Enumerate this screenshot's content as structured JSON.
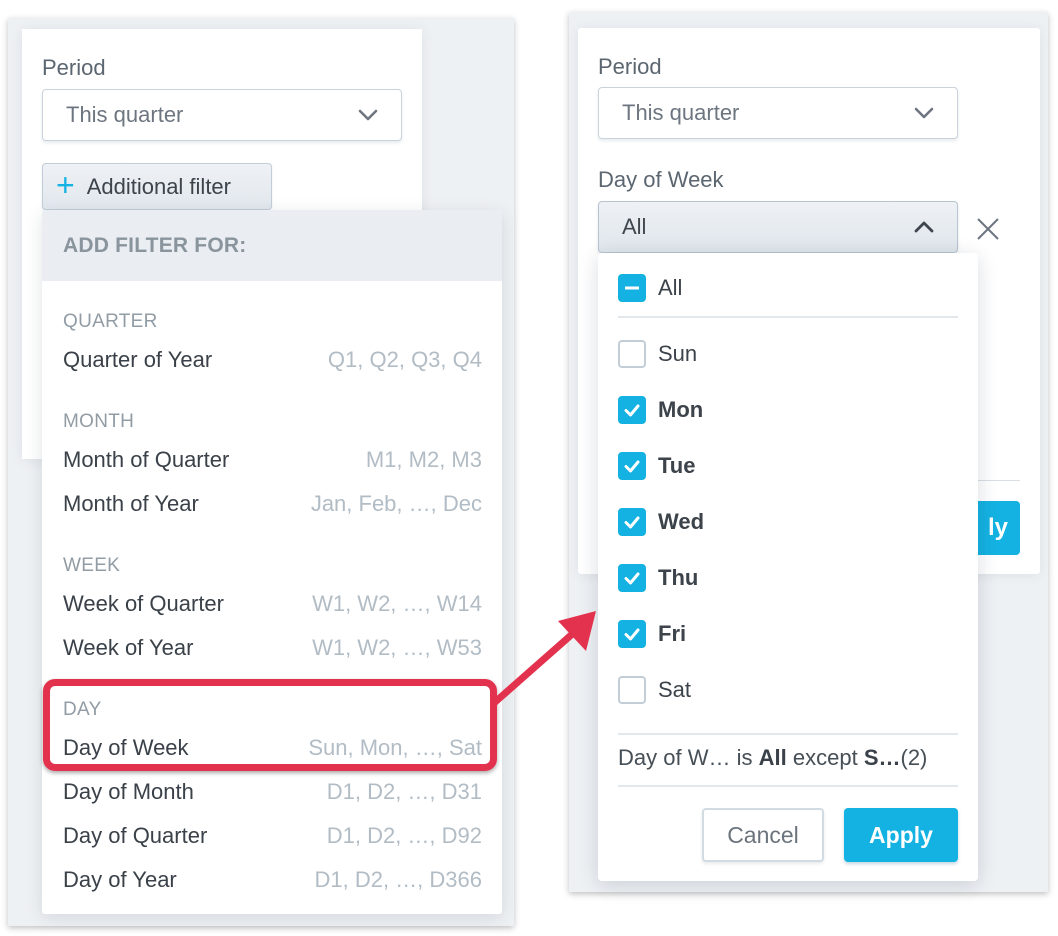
{
  "left_screen": {
    "period_label": "Period",
    "period_value": "This quarter",
    "additional_filter_label": "Additional filter",
    "add_filter_header": "ADD FILTER FOR:",
    "groups": [
      {
        "title": "QUARTER",
        "options": [
          {
            "name": "Quarter of Year",
            "hint": "Q1, Q2, Q3, Q4"
          }
        ]
      },
      {
        "title": "MONTH",
        "options": [
          {
            "name": "Month of Quarter",
            "hint": "M1, M2, M3"
          },
          {
            "name": "Month of Year",
            "hint": "Jan, Feb, …, Dec"
          }
        ]
      },
      {
        "title": "WEEK",
        "options": [
          {
            "name": "Week of Quarter",
            "hint": "W1, W2, …, W14"
          },
          {
            "name": "Week of Year",
            "hint": "W1, W2, …, W53"
          }
        ]
      },
      {
        "title": "DAY",
        "options": [
          {
            "name": "Day of Week",
            "hint": "Sun, Mon, …, Sat",
            "highlighted": true
          },
          {
            "name": "Day of Month",
            "hint": "D1, D2, …, D31"
          },
          {
            "name": "Day of Quarter",
            "hint": "D1, D2, …, D92"
          },
          {
            "name": "Day of Year",
            "hint": "D1, D2, …, D366"
          }
        ]
      }
    ]
  },
  "right_screen": {
    "period_label": "Period",
    "period_value": "This quarter",
    "day_filter_label": "Day of Week",
    "day_filter_value": "All",
    "all_option": {
      "label": "All",
      "state": "partial"
    },
    "days": [
      {
        "label": "Sun",
        "checked": false
      },
      {
        "label": "Mon",
        "checked": true
      },
      {
        "label": "Tue",
        "checked": true
      },
      {
        "label": "Wed",
        "checked": true
      },
      {
        "label": "Thu",
        "checked": true
      },
      {
        "label": "Fri",
        "checked": true
      },
      {
        "label": "Sat",
        "checked": false
      }
    ],
    "summary": {
      "attr": "Day of W…",
      "is": "is",
      "all": "All",
      "except": "except",
      "excluded": "S…",
      "count": "(2)"
    },
    "cancel_label": "Cancel",
    "apply_label": "Apply",
    "background_apply_partial": "ly"
  },
  "colors": {
    "accent": "#14b2e2",
    "annotation": "#e3324d"
  }
}
